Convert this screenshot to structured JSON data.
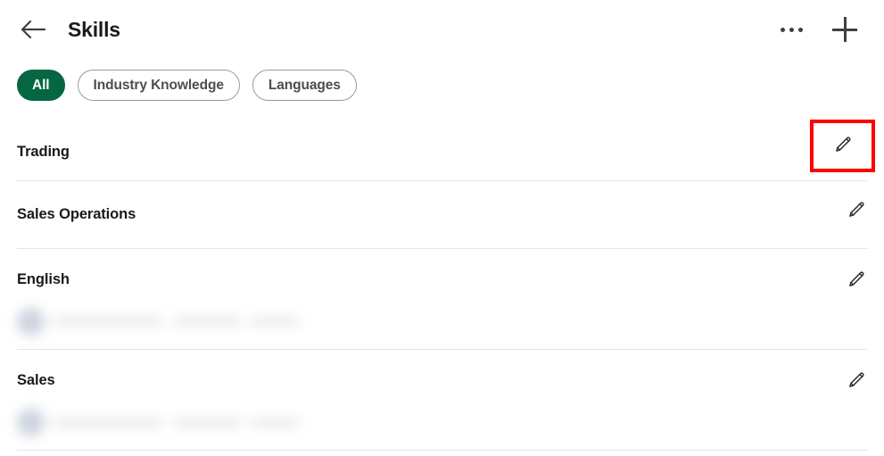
{
  "header": {
    "back_icon": "arrow-left-icon",
    "title": "Skills",
    "more_icon": "ellipsis-icon",
    "add_icon": "plus-icon"
  },
  "filters": {
    "items": [
      {
        "label": "All",
        "active": true
      },
      {
        "label": "Industry Knowledge",
        "active": false
      },
      {
        "label": "Languages",
        "active": false
      }
    ]
  },
  "skills": [
    {
      "name": "Trading",
      "edit_icon": "pencil-icon",
      "highlighted": true,
      "has_endorsement": false
    },
    {
      "name": "Sales Operations",
      "edit_icon": "pencil-icon",
      "highlighted": false,
      "has_endorsement": false
    },
    {
      "name": "English",
      "edit_icon": "pencil-icon",
      "highlighted": false,
      "has_endorsement": true
    },
    {
      "name": "Sales",
      "edit_icon": "pencil-icon",
      "highlighted": false,
      "has_endorsement": true
    }
  ],
  "colors": {
    "accent_green": "#056642",
    "highlight_red": "#ff0000",
    "text_primary": "#1a1a1a",
    "divider": "#e4e4e4"
  }
}
